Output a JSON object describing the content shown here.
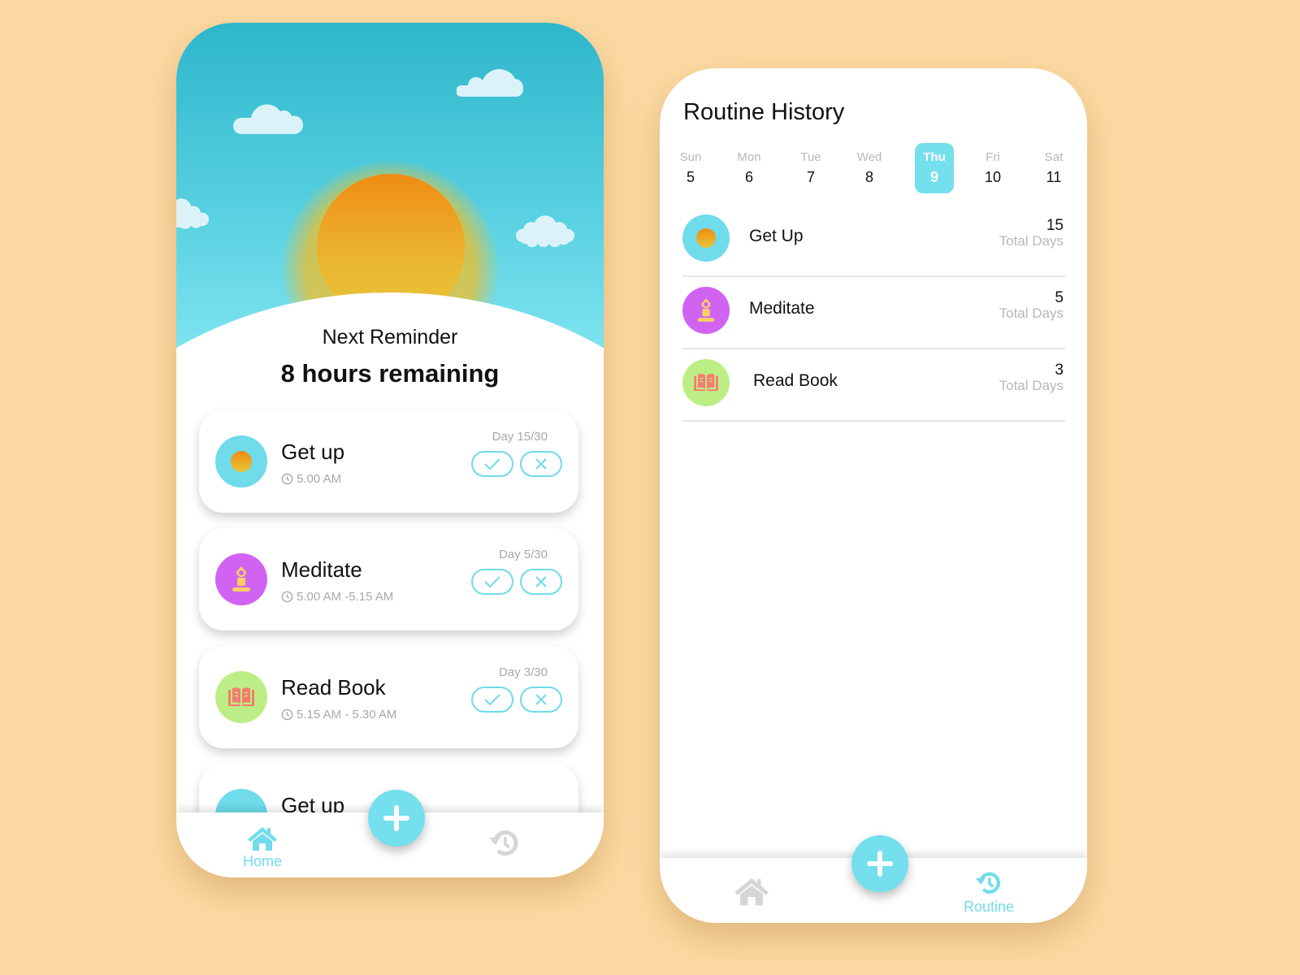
{
  "colors": {
    "background": "#fcd9a3",
    "accent": "#74dfed",
    "get_up": "#6fdbeb",
    "meditate": "#d163f3",
    "read_book": "#bdee86",
    "inactive_icon": "#d6d6d6"
  },
  "home": {
    "reminder_label": "Next Reminder",
    "reminder_value": "8 hours remaining",
    "routines": [
      {
        "title": "Get up",
        "time": "5.00 AM",
        "day": "Day 15/30",
        "icon": "sun-icon",
        "progress": {
          "current": 15,
          "total": 30
        }
      },
      {
        "title": "Meditate",
        "time": "5.00 AM -5.15 AM",
        "day": "Day 5/30",
        "icon": "meditation-icon",
        "progress": {
          "current": 5,
          "total": 30
        }
      },
      {
        "title": "Read Book",
        "time": "5.15 AM - 5.30 AM",
        "day": "Day 3/30",
        "icon": "book-icon",
        "progress": {
          "current": 3,
          "total": 30
        }
      },
      {
        "title": "Get up",
        "icon": "sun-icon"
      }
    ],
    "nav": {
      "home_label": "Home",
      "add_icon": "plus-icon",
      "history_icon": "history-icon"
    }
  },
  "history": {
    "title": "Routine History",
    "days": [
      {
        "name": "Sun",
        "num": "5"
      },
      {
        "name": "Mon",
        "num": "6"
      },
      {
        "name": "Tue",
        "num": "7"
      },
      {
        "name": "Wed",
        "num": "8"
      },
      {
        "name": "Thu",
        "num": "9",
        "selected": true
      },
      {
        "name": "Fri",
        "num": "10"
      },
      {
        "name": "Sat",
        "num": "11"
      }
    ],
    "items": [
      {
        "name": "Get Up",
        "count": "15",
        "unit": "Total Days",
        "icon": "sun-icon"
      },
      {
        "name": "Meditate",
        "count": "5",
        "unit": "Total Days",
        "icon": "meditation-icon"
      },
      {
        "name": "Read Book",
        "count": "3",
        "unit": "Total Days",
        "icon": "book-icon"
      }
    ],
    "nav": {
      "routine_label": "Routine",
      "add_icon": "plus-icon",
      "home_icon": "home-icon"
    }
  }
}
